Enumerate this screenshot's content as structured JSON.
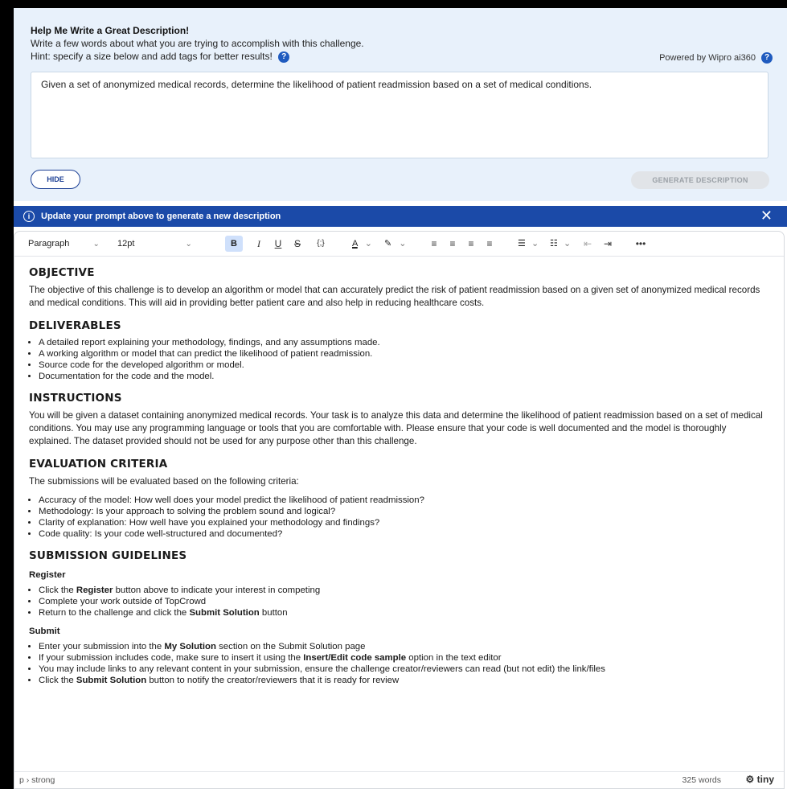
{
  "assistant": {
    "title": "Help Me Write a Great Description!",
    "line1": "Write a few words about what you are trying to accomplish with this challenge.",
    "hint": "Hint: specify a size below and add tags for better results!",
    "powered_by": "Powered by Wipro ai360",
    "prompt_value": "Given a set of anonymized medical records, determine the likelihood of patient readmission based on a set of medical conditions.",
    "hide_label": "HIDE",
    "generate_label": "GENERATE DESCRIPTION"
  },
  "banner": {
    "text": "Update your prompt above to generate a new description",
    "close": "✕"
  },
  "toolbar": {
    "block_format": "Paragraph",
    "font_size": "12pt",
    "bold": "B",
    "italic": "I",
    "underline": "U",
    "strike": "S",
    "code": "{;}",
    "text_color": "A",
    "more": "•••"
  },
  "content": {
    "objective_heading": "OBJECTIVE",
    "objective_text": "The objective of this challenge is to develop an algorithm or model that can accurately predict the risk of patient readmission based on a given set of anonymized medical records and medical conditions. This will aid in providing better patient care and also help in reducing healthcare costs.",
    "deliverables_heading": "DELIVERABLES",
    "deliverables": [
      "A detailed report explaining your methodology, findings, and any assumptions made.",
      "A working algorithm or model that can predict the likelihood of patient readmission.",
      "Source code for the developed algorithm or model.",
      "Documentation for the code and the model."
    ],
    "instructions_heading": "INSTRUCTIONS",
    "instructions_text": "You will be given a dataset containing anonymized medical records. Your task is to analyze this data and determine the likelihood of patient readmission based on a set of medical conditions. You may use any programming language or tools that you are comfortable with. Please ensure that your code is well documented and the model is thoroughly explained. The dataset provided should not be used for any purpose other than this challenge.",
    "evaluation_heading": "EVALUATION CRITERIA",
    "evaluation_intro": "The submissions will be evaluated based on the following criteria:",
    "evaluation": [
      "Accuracy of the model: How well does your model predict the likelihood of patient readmission?",
      "Methodology: Is your approach to solving the problem sound and logical?",
      "Clarity of explanation: How well have you explained your methodology and findings?",
      "Code quality: Is your code well-structured and documented?"
    ],
    "submission_heading": "SUBMISSION GUIDELINES",
    "register_heading": "Register",
    "register_1a": "Click the ",
    "register_1b": "Register",
    "register_1c": " button above to indicate your interest in competing",
    "register_2": "Complete your work outside of TopCrowd",
    "register_3a": "Return to the challenge and click the ",
    "register_3b": "Submit Solution",
    "register_3c": " button",
    "submit_heading": "Submit",
    "submit_1a": "Enter your submission into the ",
    "submit_1b": "My Solution",
    "submit_1c": " section on the Submit Solution page",
    "submit_2a": "If your submission includes code, make sure to insert it using the ",
    "submit_2b": "Insert/Edit code sample",
    "submit_2c": " option in the text editor",
    "submit_3": "You may include links to any relevant content in your submission, ensure the challenge creator/reviewers can read (but not edit) the link/files",
    "submit_4a": "Click the ",
    "submit_4b": "Submit Solution",
    "submit_4c": " button to notify the creator/reviewers that it is ready for review"
  },
  "status": {
    "path": "p › strong",
    "word_count": "325 words",
    "brand": "tiny"
  },
  "colors": {
    "assistant_bg": "#e8f1fb",
    "banner_bg": "#1b4aa8",
    "accent": "#1c3f94"
  }
}
